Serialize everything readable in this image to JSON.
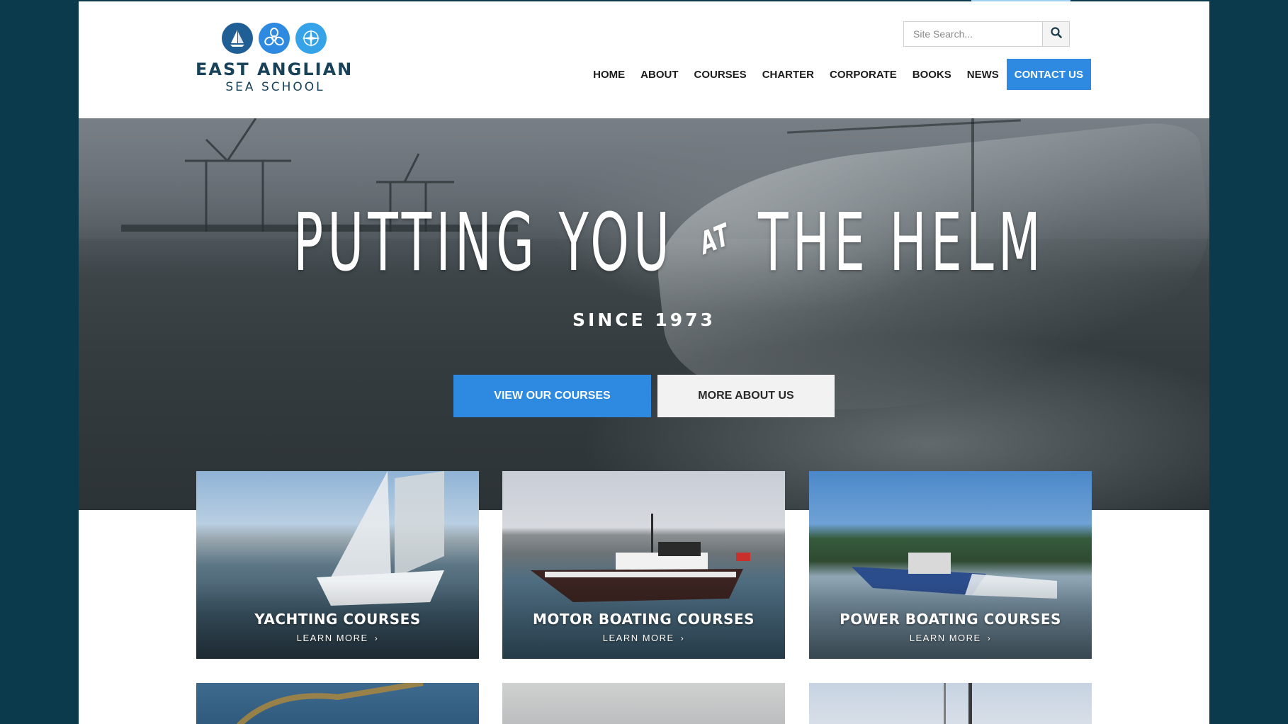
{
  "brand": {
    "name_line1": "EAST ANGLIAN",
    "name_line2": "SEA SCHOOL",
    "icons": [
      "sailboat-icon",
      "propeller-icon",
      "compass-icon"
    ],
    "colors": [
      "#17425a",
      "#2e8ae0",
      "#36a3e8"
    ]
  },
  "search": {
    "placeholder": "Site Search..."
  },
  "nav": {
    "items": [
      {
        "label": "HOME"
      },
      {
        "label": "ABOUT"
      },
      {
        "label": "COURSES"
      },
      {
        "label": "CHARTER"
      },
      {
        "label": "CORPORATE"
      },
      {
        "label": "BOOKS"
      },
      {
        "label": "NEWS"
      },
      {
        "label": "CONTACT US"
      }
    ]
  },
  "hero": {
    "title_part1": "PUTTING YOU",
    "title_at": "AT",
    "title_part2": "THE HELM",
    "subtitle": "SINCE 1973",
    "primary_button": "VIEW OUR COURSES",
    "secondary_button": "MORE ABOUT US"
  },
  "cards": [
    {
      "title": "YACHTING COURSES",
      "link": "LEARN MORE"
    },
    {
      "title": "MOTOR BOATING COURSES",
      "link": "LEARN MORE"
    },
    {
      "title": "POWER BOATING COURSES",
      "link": "LEARN MORE"
    }
  ],
  "theme": {
    "accent": "#2e8ae0",
    "frame_background": "#0c3a4d",
    "secondary_button_bg": "#f2f2f2"
  }
}
